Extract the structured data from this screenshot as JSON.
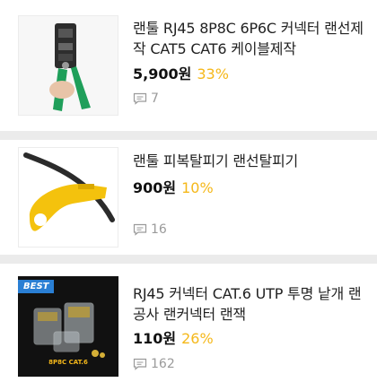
{
  "products": [
    {
      "title": "랜툴 RJ45 8P8C 6P6C 커넥터 랜선제작 CAT5 CAT6 케이블제작",
      "price": "5,900원",
      "discount": "33%",
      "review_count": "7",
      "image_icon": "crimping-tool-icon"
    },
    {
      "title": "랜툴 피복탈피기 랜선탈피기",
      "price": "900원",
      "discount": "10%",
      "review_count": "16",
      "image_icon": "cable-stripper-icon"
    },
    {
      "title": "RJ45 커넥터 CAT.6 UTP 투명 낱개 랜공사 랜커넥터 랜잭",
      "price": "110원",
      "discount": "26%",
      "review_count": "162",
      "image_icon": "rj45-connector-icon",
      "badge": "BEST",
      "image_caption": "8P8C CAT.6"
    }
  ],
  "colors": {
    "discount": "#f5b81a",
    "separator": "#ebebeb",
    "best_badge": "#2a7fd4",
    "caption": "#f5b81a"
  }
}
